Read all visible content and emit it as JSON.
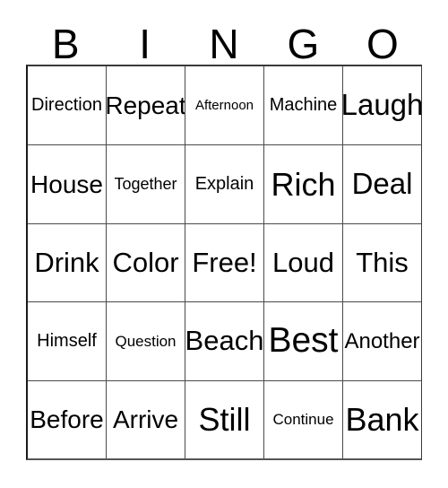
{
  "card": {
    "title": "Bingo Card",
    "header_letters": [
      "B",
      "I",
      "N",
      "G",
      "O"
    ],
    "colors": {
      "background": "#ffffff",
      "text": "#000000",
      "grid_line": "#4a4a4a",
      "outer_border": "#1a1a1a"
    },
    "grid": {
      "columns": 5,
      "rows": 5,
      "free_space_label": "Free!",
      "free_space_position": {
        "row": 3,
        "column": 3
      }
    },
    "rows": [
      [
        {
          "label": "Direction",
          "size": "md"
        },
        {
          "label": "Repeat",
          "size": "xl"
        },
        {
          "label": "Afternoon",
          "size": "xs"
        },
        {
          "label": "Machine",
          "size": "md"
        },
        {
          "label": "Laugh",
          "size": "3xl"
        }
      ],
      [
        {
          "label": "House",
          "size": "xl"
        },
        {
          "label": "Together",
          "size": "smd"
        },
        {
          "label": "Explain",
          "size": "md"
        },
        {
          "label": "Rich",
          "size": "4xl"
        },
        {
          "label": "Deal",
          "size": "3xl"
        }
      ],
      [
        {
          "label": "Drink",
          "size": "2xl"
        },
        {
          "label": "Color",
          "size": "2xl"
        },
        {
          "label": "Free!",
          "size": "2xl"
        },
        {
          "label": "Loud",
          "size": "2xl"
        },
        {
          "label": "This",
          "size": "2xl"
        }
      ],
      [
        {
          "label": "Himself",
          "size": "md"
        },
        {
          "label": "Question",
          "size": "sm"
        },
        {
          "label": "Beach",
          "size": "2xl"
        },
        {
          "label": "Best",
          "size": "5xl"
        },
        {
          "label": "Another",
          "size": "lg"
        }
      ],
      [
        {
          "label": "Before",
          "size": "xl"
        },
        {
          "label": "Arrive",
          "size": "xl"
        },
        {
          "label": "Still",
          "size": "4xl"
        },
        {
          "label": "Continue",
          "size": "sm"
        },
        {
          "label": "Bank",
          "size": "4xl"
        }
      ]
    ]
  }
}
